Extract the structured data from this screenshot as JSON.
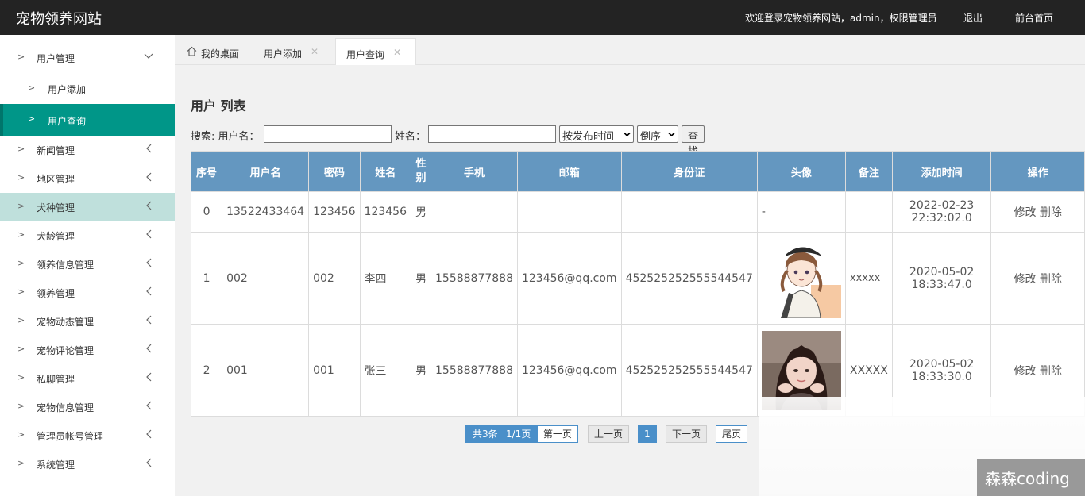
{
  "header": {
    "logo": "宠物领养网站",
    "welcome": "欢迎登录宠物领养网站，admin，权限管理员",
    "logout": "退出",
    "home": "前台首页"
  },
  "sidebar": {
    "items": [
      {
        "label": "用户管理"
      },
      {
        "label": "用户添加"
      },
      {
        "label": "用户查询"
      },
      {
        "label": "新闻管理"
      },
      {
        "label": "地区管理"
      },
      {
        "label": "犬种管理"
      },
      {
        "label": "犬龄管理"
      },
      {
        "label": "领养信息管理"
      },
      {
        "label": "领养管理"
      },
      {
        "label": "宠物动态管理"
      },
      {
        "label": "宠物评论管理"
      },
      {
        "label": "私聊管理"
      },
      {
        "label": "宠物信息管理"
      },
      {
        "label": "管理员帐号管理"
      },
      {
        "label": "系统管理"
      }
    ]
  },
  "tabs": [
    {
      "label": "我的桌面"
    },
    {
      "label": "用户添加"
    },
    {
      "label": "用户查询"
    }
  ],
  "main": {
    "title": "用户 列表",
    "search": {
      "label": "搜索: 用户名：",
      "name_label": "姓名：",
      "sort_by": "按发布时间",
      "order": "倒序",
      "button": "查找"
    },
    "columns": [
      "序号",
      "用户名",
      "密码",
      "姓名",
      "性别",
      "手机",
      "邮箱",
      "身份证",
      "头像",
      "备注",
      "添加时间",
      "操作"
    ],
    "rows": [
      {
        "idx": "0",
        "username": "13522433464",
        "password": "123456",
        "name": "123456",
        "gender": "男",
        "phone": "",
        "email": "",
        "idcard": "",
        "avatar": "-",
        "remark": "",
        "date": "2022-02-23",
        "time": "22:32:02.0",
        "edit": "修改",
        "del": "删除"
      },
      {
        "idx": "1",
        "username": "002",
        "password": "002",
        "name": "李四",
        "gender": "男",
        "phone": "15588877888",
        "email": "123456@qq.com",
        "idcard": "452525252555544547",
        "avatar": "",
        "remark": "xxxxx",
        "date": "2020-05-02",
        "time": "18:33:47.0",
        "edit": "修改",
        "del": "删除"
      },
      {
        "idx": "2",
        "username": "001",
        "password": "001",
        "name": "张三",
        "gender": "男",
        "phone": "15588877888",
        "email": "123456@qq.com",
        "idcard": "452525252555544547",
        "avatar": "",
        "remark": "XXXXX",
        "date": "2020-05-02",
        "time": "18:33:30.0",
        "edit": "修改",
        "del": "删除"
      }
    ]
  },
  "pager": {
    "total": "共3条",
    "pages": "1/1页",
    "first": "第一页",
    "prev": "上一页",
    "current": "1",
    "next": "下一页",
    "last": "尾页"
  },
  "watermark": "森森coding",
  "colors": {
    "accent": "#009688",
    "header": "#232323",
    "table_header": "#6497c0"
  }
}
